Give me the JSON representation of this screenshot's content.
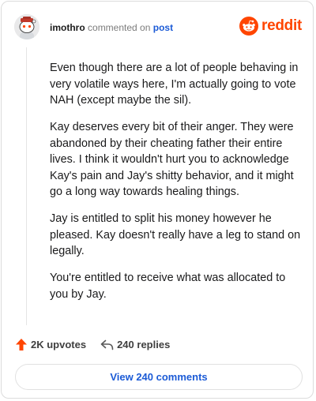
{
  "header": {
    "username": "imothro",
    "action_text": "commented on",
    "post_link": "post",
    "brand_name": "reddit",
    "brand_color": "#ff4500"
  },
  "comment": {
    "paragraphs": [
      "Even though there are a lot of people behaving in very volatile ways here, I'm actually going to vote NAH (except maybe the sil).",
      "Kay deserves every bit of their anger. They were abandoned by their cheating father their entire lives. I think it wouldn't hurt you to acknowledge Kay's pain and Jay's shitty behavior, and it might go a long way towards healing things.",
      "Jay is entitled to split his money however he pleased. Kay doesn't really have a leg to stand on legally.",
      "You're entitled to receive what was allocated to you by Jay."
    ]
  },
  "footer": {
    "upvotes": "2K upvotes",
    "replies": "240 replies",
    "view_button": "View 240 comments",
    "upvote_icon": "upvote-arrow-icon",
    "reply_icon": "reply-arrow-icon",
    "accent_color": "#ff4500",
    "link_color": "#1c5bd6"
  }
}
